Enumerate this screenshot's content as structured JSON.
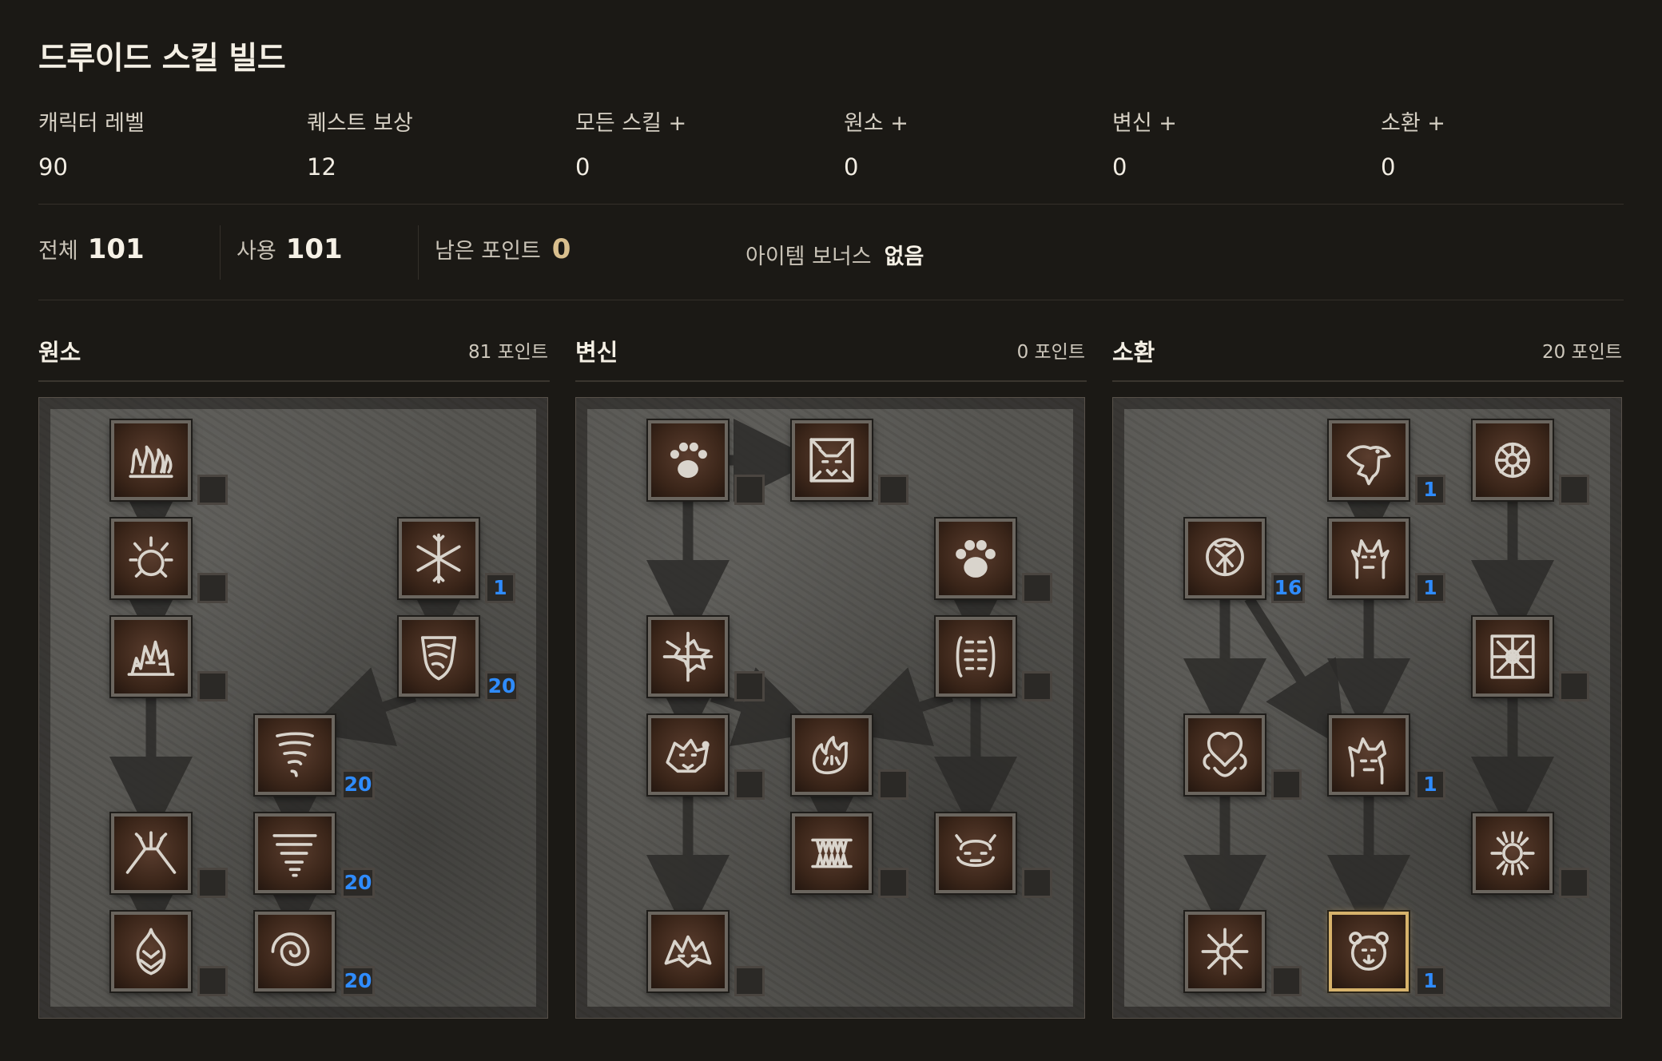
{
  "page_title": "드루이드 스킬 빌드",
  "stats": [
    {
      "label": "캐릭터 레벨",
      "value": "90"
    },
    {
      "label": "퀘스트 보상",
      "value": "12"
    },
    {
      "label": "모든 스킬 +",
      "value": "0"
    },
    {
      "label": "원소 +",
      "value": "0"
    },
    {
      "label": "변신 +",
      "value": "0"
    },
    {
      "label": "소환 +",
      "value": "0"
    }
  ],
  "summary": {
    "total_label": "전체",
    "total_value": "101",
    "used_label": "사용",
    "used_value": "101",
    "remaining_label": "남은 포인트",
    "remaining_value": "0",
    "item_bonus_label": "아이템 보너스",
    "item_bonus_value": "없음"
  },
  "colors": {
    "background": "#1b1915",
    "level_text": "#2f8cff",
    "remaining_value": "#d9bf8e",
    "selected_border": "#d6b26b"
  },
  "trees": [
    {
      "name": "원소",
      "points": "81 포인트",
      "skills": [
        {
          "icon": "firestorm-icon",
          "level": ""
        },
        {
          "icon": "molten-boulder-icon",
          "level": ""
        },
        {
          "icon": "arctic-blast-icon",
          "level": "1"
        },
        {
          "icon": "fissure-icon",
          "level": ""
        },
        {
          "icon": "cyclone-armor-icon",
          "level": "20"
        },
        {
          "icon": "twister-icon",
          "level": "20"
        },
        {
          "icon": "volcano-icon",
          "level": ""
        },
        {
          "icon": "tornado-icon",
          "level": "20"
        },
        {
          "icon": "armageddon-icon",
          "level": ""
        },
        {
          "icon": "hurricane-icon",
          "level": "20"
        }
      ]
    },
    {
      "name": "변신",
      "points": "0 포인트",
      "skills": [
        {
          "icon": "werewolf-icon",
          "level": ""
        },
        {
          "icon": "lycanthropy-icon",
          "level": ""
        },
        {
          "icon": "werebear-icon",
          "level": ""
        },
        {
          "icon": "feral-rage-icon",
          "level": ""
        },
        {
          "icon": "maul-icon",
          "level": ""
        },
        {
          "icon": "rabies-icon",
          "level": ""
        },
        {
          "icon": "fire-claws-icon",
          "level": ""
        },
        {
          "icon": "hunger-icon",
          "level": ""
        },
        {
          "icon": "shock-wave-icon",
          "level": ""
        },
        {
          "icon": "fury-icon",
          "level": ""
        }
      ]
    },
    {
      "name": "소환",
      "points": "20 포인트",
      "skills": [
        {
          "icon": "raven-icon",
          "level": "1"
        },
        {
          "icon": "poison-creeper-icon",
          "level": ""
        },
        {
          "icon": "oak-sage-icon",
          "level": "16"
        },
        {
          "icon": "summon-spirit-wolf-icon",
          "level": "1"
        },
        {
          "icon": "carrion-vine-icon",
          "level": ""
        },
        {
          "icon": "heart-of-wolverine-icon",
          "level": ""
        },
        {
          "icon": "summon-dire-wolf-icon",
          "level": "1"
        },
        {
          "icon": "solar-creeper-icon",
          "level": ""
        },
        {
          "icon": "spirit-of-barbs-icon",
          "level": ""
        },
        {
          "icon": "summon-grizzly-icon",
          "level": "1"
        }
      ]
    }
  ]
}
